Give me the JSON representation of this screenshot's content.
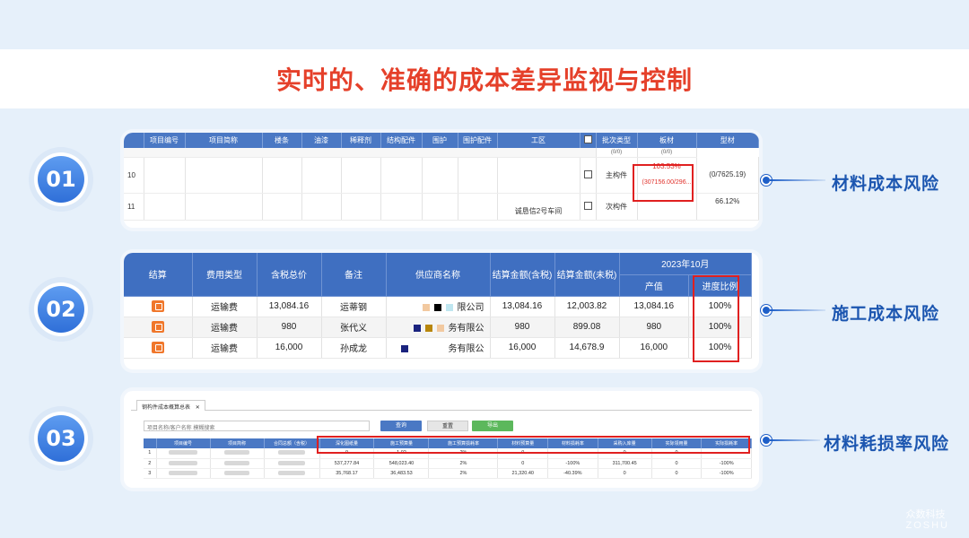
{
  "title": "实时的、准确的成本差异监视与控制",
  "accent_color": "#e5402a",
  "brand_color": "#1e5fc8",
  "sections": [
    {
      "number": "01",
      "label": "材料成本风险"
    },
    {
      "number": "02",
      "label": "施工成本风险"
    },
    {
      "number": "03",
      "label": "材料耗损率风险"
    }
  ],
  "table1": {
    "headers": [
      "项目编号",
      "项目简称",
      "楼条",
      "油漆",
      "稀释剂",
      "结构配件",
      "围护",
      "围护配件",
      "工区",
      "",
      "批次类型",
      "板材",
      "型材"
    ],
    "sub_row": {
      "col11": "(0/0)",
      "col12": "(0/0)"
    },
    "rows": [
      {
        "no": "10",
        "area": "",
        "batch": "主构件",
        "plate_pct": "103.53%",
        "plate_val": "(307156.00/296...",
        "profile": "(0/7625.19)"
      },
      {
        "no": "11",
        "area": "诚恳信2号车间",
        "batch": "次构件",
        "plate_pct": "",
        "plate_val": "",
        "profile": "66.12%"
      }
    ]
  },
  "table2": {
    "headers": [
      "结算",
      "费用类型",
      "含税总价",
      "备注",
      "供应商名称",
      "结算金额(含税)",
      "结算金额(未税)"
    ],
    "group_header": "2023年10月",
    "group_sub": [
      "产值",
      "进度比例"
    ],
    "rows": [
      {
        "type": "运输费",
        "total": "13,084.16",
        "note": "运蒂钢",
        "supplier": "限公司",
        "tax": "13,084.16",
        "notax": "12,003.82",
        "value": "13,084.16",
        "ratio": "100%"
      },
      {
        "type": "运输费",
        "total": "980",
        "note": "张代义",
        "supplier": "务有限公",
        "tax": "980",
        "notax": "899.08",
        "value": "980",
        "ratio": "100%"
      },
      {
        "type": "运输费",
        "total": "16,000",
        "note": "孙成龙",
        "supplier": "务有限公",
        "tax": "16,000",
        "notax": "14,678.9",
        "value": "16,000",
        "ratio": "100%"
      }
    ]
  },
  "table3": {
    "tab_label": "钢构件成本概算总表",
    "search_placeholder": "项目名称/客户名称 模糊搜索",
    "buttons": {
      "query": "查询",
      "reset": "重置",
      "export": "导出"
    },
    "headers": [
      "",
      "项目编号",
      "项目简称",
      "合同总额（含税）",
      "深化图纸量",
      "施工预算量",
      "施工预算损耗率",
      "材料预算量",
      "材料损耗率",
      "采购入库量",
      "实际领用量",
      "实际损耗率"
    ],
    "rows": [
      {
        "idx": "1",
        "c4": "0",
        "c5": "1.02",
        "c6": "2%",
        "c7": "0",
        "c8": "",
        "c9": "0",
        "c10": "0",
        "c11": ""
      },
      {
        "idx": "2",
        "c4": "537,277.84",
        "c5": "548,023.40",
        "c6": "2%",
        "c7": "0",
        "c8": "-100%",
        "c9": "311,700.45",
        "c10": "0",
        "c11": "-100%"
      },
      {
        "idx": "3",
        "c4": "35,768.17",
        "c5": "36,483.53",
        "c6": "2%",
        "c7": "21,320.40",
        "c8": "-40.39%",
        "c9": "0",
        "c10": "0",
        "c11": "-100%"
      }
    ]
  },
  "watermark": {
    "cn": "众数科技",
    "en": "ZOSHU"
  }
}
